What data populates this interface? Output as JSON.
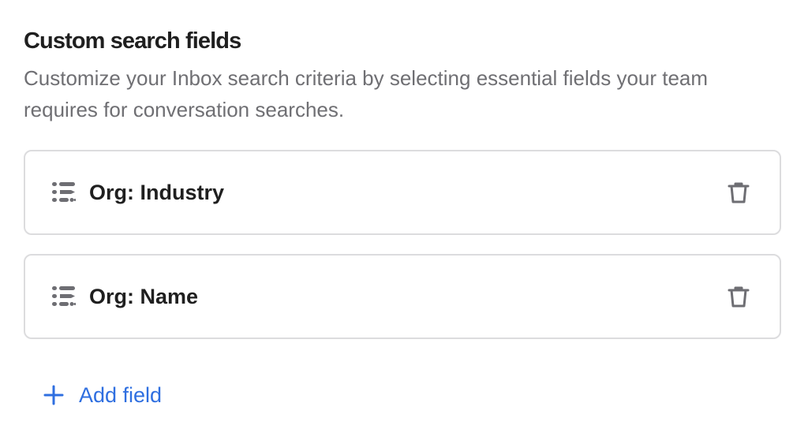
{
  "section": {
    "title": "Custom search fields",
    "description": "Customize your Inbox search criteria by selecting essential fields your team requires for conversation searches."
  },
  "fields": [
    {
      "label": "Org: Industry",
      "icon": "field-list-icon",
      "action_icon": "trash-icon"
    },
    {
      "label": "Org: Name",
      "icon": "field-list-icon",
      "action_icon": "trash-icon"
    }
  ],
  "add_field": {
    "label": "Add field",
    "icon": "plus-icon"
  },
  "colors": {
    "title": "#1f1f1f",
    "description": "#6f6f73",
    "border": "#dcdcde",
    "icon": "#6e6e73",
    "accent": "#2f6fe0"
  }
}
